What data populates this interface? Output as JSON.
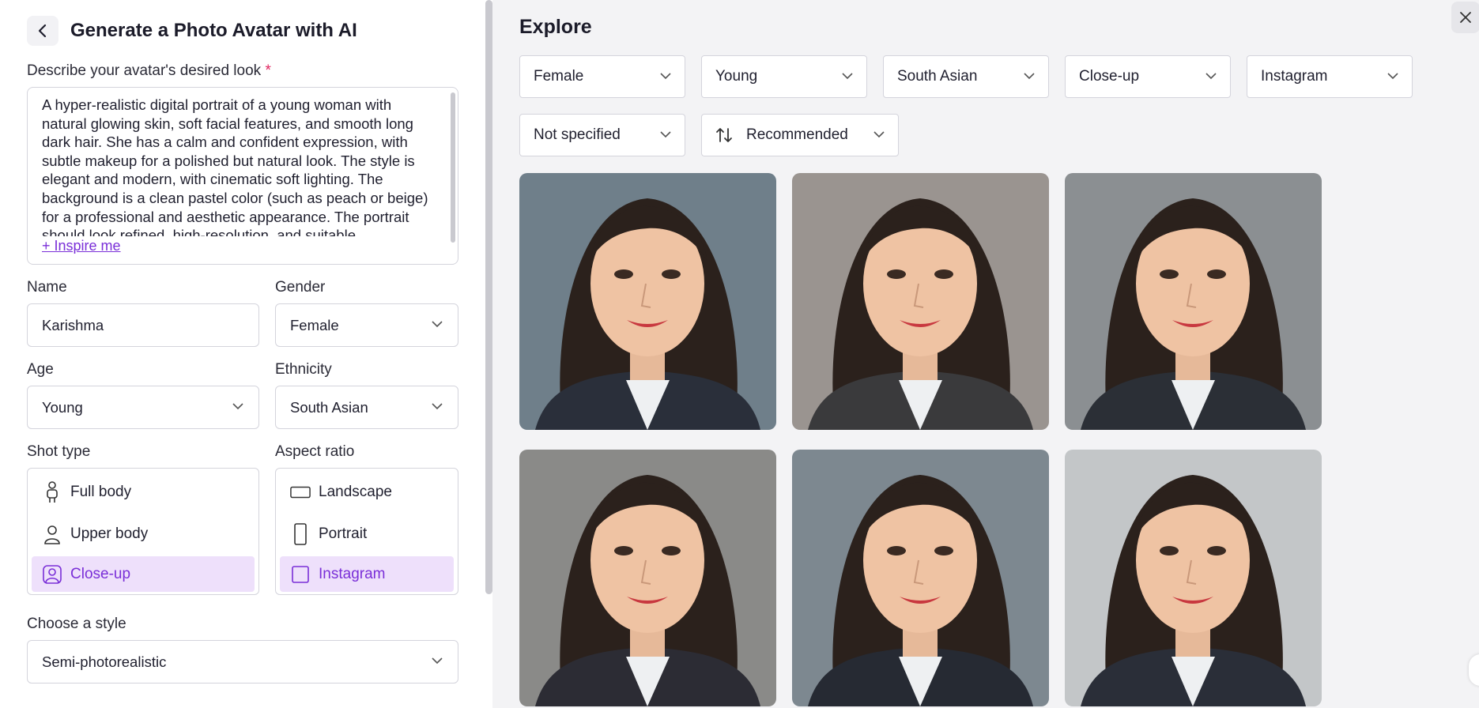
{
  "header": {
    "title": "Generate a Photo Avatar with AI",
    "back_icon": "chevron-left-icon"
  },
  "describe": {
    "label": "Describe your avatar's desired look",
    "required_mark": "*",
    "value": "A hyper-realistic digital portrait of a young woman with natural glowing skin, soft facial features, and smooth long dark hair. She has a calm and confident expression, with subtle makeup for a polished but natural look. The style is elegant and modern, with cinematic soft lighting. The background is a clean pastel color (such as peach or beige) for a professional and aesthetic appearance. The portrait should look refined, high-resolution, and suitable",
    "inspire_label": "+ Inspire me"
  },
  "name": {
    "label": "Name",
    "value": "Karishma"
  },
  "gender": {
    "label": "Gender",
    "value": "Female"
  },
  "age": {
    "label": "Age",
    "value": "Young"
  },
  "ethnicity": {
    "label": "Ethnicity",
    "value": "South Asian"
  },
  "shot_type": {
    "label": "Shot type",
    "options": [
      {
        "label": "Full body",
        "icon": "full-body-icon",
        "selected": false
      },
      {
        "label": "Upper body",
        "icon": "upper-body-icon",
        "selected": false
      },
      {
        "label": "Close-up",
        "icon": "close-up-icon",
        "selected": true
      }
    ]
  },
  "aspect_ratio": {
    "label": "Aspect ratio",
    "options": [
      {
        "label": "Landscape",
        "icon": "landscape-icon",
        "selected": false
      },
      {
        "label": "Portrait",
        "icon": "portrait-icon",
        "selected": false
      },
      {
        "label": "Instagram",
        "icon": "square-icon",
        "selected": true
      }
    ]
  },
  "style": {
    "label": "Choose a style",
    "value": "Semi-photorealistic"
  },
  "explore": {
    "title": "Explore",
    "filters": [
      "Female",
      "Young",
      "South Asian",
      "Close-up",
      "Instagram",
      "Not specified"
    ],
    "sort": {
      "label": "Recommended",
      "icon": "sort-icon"
    },
    "results": [
      {
        "bg": "#6f7f8a",
        "suit": "#2a2f3a"
      },
      {
        "bg": "#9a9490",
        "suit": "#3a3a3c"
      },
      {
        "bg": "#8b8f92",
        "suit": "#2b2f36"
      },
      {
        "bg": "#8a8a88",
        "suit": "#2c2c34"
      },
      {
        "bg": "#7d8890",
        "suit": "#262a33"
      },
      {
        "bg": "#c3c6c8",
        "suit": "#2a2e38"
      }
    ]
  },
  "colors": {
    "accent": "#7a2fd8",
    "accent_bg": "#eee0fb",
    "panel_bg": "#f3f3f5"
  }
}
